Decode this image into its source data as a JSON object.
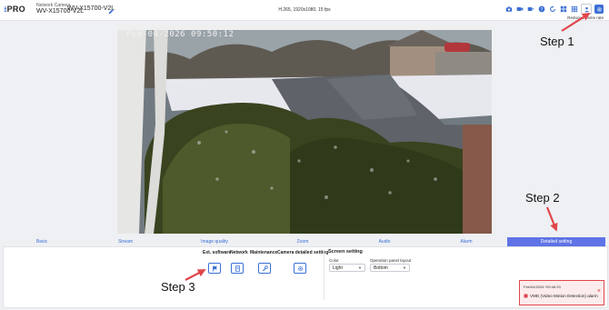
{
  "header": {
    "logo_text": "PRO",
    "camera_label": "Network Camera",
    "camera_model": "WV-X15700-V2L",
    "camera_title": "WV-X15700-V2L",
    "stream_info": "H.265, 1920x1080, 15 fps",
    "reduced_label": "Reduced frame rate",
    "icons": [
      "camera-icon",
      "video-icon",
      "stream-icon",
      "help-icon",
      "refresh-icon",
      "grid4-icon",
      "grid9-icon",
      "person-icon",
      "gear-icon"
    ]
  },
  "video": {
    "timestamp": "Feb-04-2026 09:50:12"
  },
  "tabs": [
    {
      "label": "Basic"
    },
    {
      "label": "Stream"
    },
    {
      "label": "Image quality"
    },
    {
      "label": "Zoom"
    },
    {
      "label": "Audio"
    },
    {
      "label": "Alarm"
    },
    {
      "label": "Detailed setting",
      "active": true
    }
  ],
  "panel": {
    "sections": [
      {
        "title": "Ext. software",
        "icon": "flag-icon"
      },
      {
        "title": "Network",
        "icon": "document-icon"
      },
      {
        "title": "Maintenance",
        "icon": "wrench-icon"
      },
      {
        "title": "Camera detailed setting",
        "icon": "gear-icon"
      }
    ],
    "screen_setting": {
      "title": "Screen setting",
      "color_label": "Color",
      "color_value": "Light",
      "layout_label": "Operation panel layout",
      "layout_value": "Bottom"
    }
  },
  "alarm": {
    "time": "Feb/04/2026 *09:46:33",
    "text": "VMD (Video Motion Detection) alarm"
  },
  "annotations": {
    "step1": "Step 1",
    "step2": "Step 2",
    "step3": "Step 3",
    "arrow_color": "#e0464b"
  },
  "colors": {
    "accent": "#3b6fd4",
    "active_tab": "#5f73e6",
    "alarm_border": "#e0464b"
  }
}
